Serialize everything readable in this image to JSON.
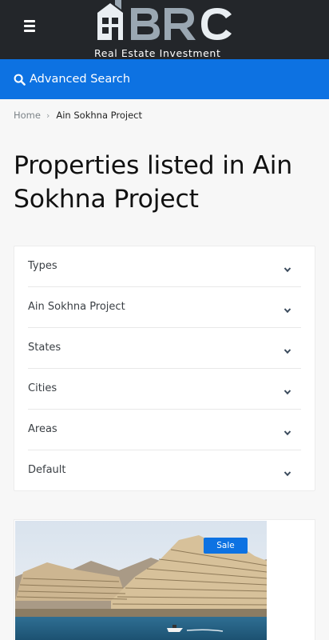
{
  "header": {
    "logo_text": "BRC",
    "tagline": "Real Estate Investment",
    "menu_icon": "hamburger-menu-icon"
  },
  "advanced_search": {
    "label": "Advanced Search",
    "icon": "search-icon"
  },
  "breadcrumb": {
    "home": "Home",
    "separator_icon": "chevron-right-icon",
    "current": "Ain Sokhna Project"
  },
  "page": {
    "title": "Properties listed in Ain Sokhna Project"
  },
  "filters": [
    {
      "label": "Types"
    },
    {
      "label": "Ain Sokhna Project"
    },
    {
      "label": "States"
    },
    {
      "label": "Cities"
    },
    {
      "label": "Areas"
    },
    {
      "label": "Default"
    }
  ],
  "listing": {
    "badge": "Sale"
  },
  "colors": {
    "header_bg": "#23262a",
    "accent": "#0d72e2",
    "page_bg": "#f7f7f7"
  }
}
